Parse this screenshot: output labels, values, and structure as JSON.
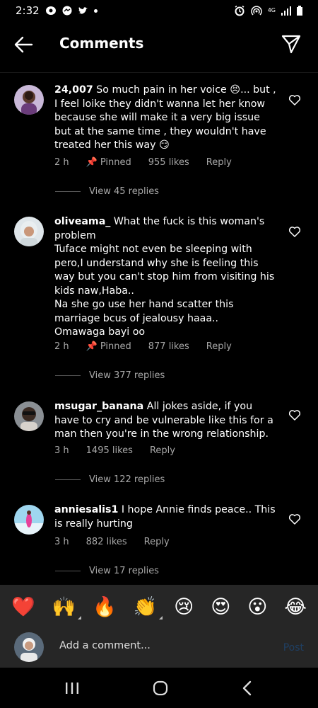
{
  "status_bar": {
    "time": "2:32",
    "network": "4G"
  },
  "header": {
    "title": "Comments"
  },
  "comments": [
    {
      "username": "24,007",
      "text": "So much pain in her voice 😣... but , I feel loike they didn't wanna let her know because she will make it a very big issue but at the same time , they wouldn't have treated her this way 😏",
      "time": "2 h",
      "pinned": "Pinned",
      "likes": "955 likes",
      "reply": "Reply",
      "view_replies": "View 45 replies"
    },
    {
      "username": "oliveama_",
      "text": "What the fuck is this woman's problem\nTuface might not even be sleeping with pero,I understand why she is feeling this way but you can't stop him from visiting his kids naw,Haba..\nNa she go use her hand scatter this marriage bcus of jealousy haaa..\nOmawaga bayi oo",
      "time": "2 h",
      "pinned": "Pinned",
      "likes": "877 likes",
      "reply": "Reply",
      "view_replies": "View 377 replies"
    },
    {
      "username": "msugar_banana",
      "text": "All jokes aside, if you have to cry and be vulnerable like this for a man then you're in the wrong relationship.",
      "time": "3 h",
      "likes": "1495 likes",
      "reply": "Reply",
      "view_replies": "View 122 replies"
    },
    {
      "username": "anniesalis1",
      "text": "I hope Annie finds peace.. This is really hurting",
      "time": "3 h",
      "likes": "882 likes",
      "reply": "Reply",
      "view_replies": "View 17 replies"
    }
  ],
  "emoji_bar": [
    "❤️",
    "🙌",
    "🔥",
    "👏",
    "😢",
    "😍",
    "😮",
    "😂"
  ],
  "composer": {
    "placeholder": "Add a comment...",
    "post_label": "Post"
  }
}
